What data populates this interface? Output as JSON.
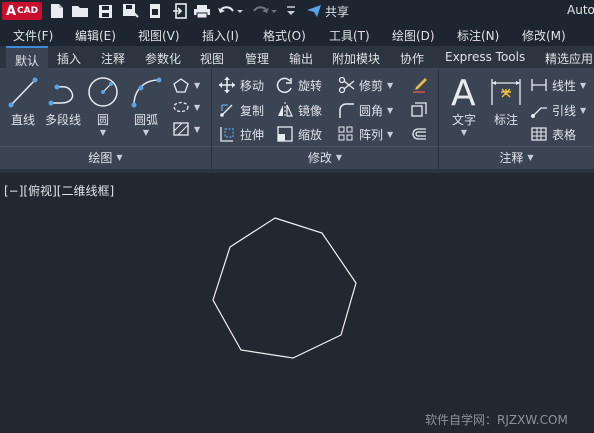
{
  "app": {
    "logo_text": "A",
    "logo_sub": "CAD",
    "title": "Auto"
  },
  "quick_access": {
    "share_label": "共享"
  },
  "menubar": {
    "items": [
      "文件(F)",
      "编辑(E)",
      "视图(V)",
      "插入(I)",
      "格式(O)",
      "工具(T)",
      "绘图(D)",
      "标注(N)",
      "修改(M)"
    ]
  },
  "ribbon_tabs": {
    "items": [
      "默认",
      "插入",
      "注释",
      "参数化",
      "视图",
      "管理",
      "输出",
      "附加模块",
      "协作",
      "Express Tools",
      "精选应用"
    ],
    "active": "默认"
  },
  "draw_panel": {
    "title": "绘图",
    "line": "直线",
    "polyline": "多段线",
    "circle": "圆",
    "arc": "圆弧"
  },
  "modify_panel": {
    "title": "修改",
    "move": "移动",
    "rotate": "旋转",
    "trim": "修剪",
    "copy": "复制",
    "mirror": "镜像",
    "fillet": "圆角",
    "stretch": "拉伸",
    "scale": "缩放",
    "array": "阵列"
  },
  "annotation_panel": {
    "title": "注释",
    "text": "文字",
    "dimension": "标注",
    "linear": "线性",
    "leader": "引线",
    "table": "表格"
  },
  "viewport": {
    "label": "[−][俯视][二维线框]",
    "shape": "octagon"
  },
  "watermark": "软件自学网：RJZXW.COM",
  "colors": {
    "background": "#212830",
    "ribbon": "#3b4453",
    "accent": "#3f8ad8",
    "logo_red": "#c8102e"
  }
}
